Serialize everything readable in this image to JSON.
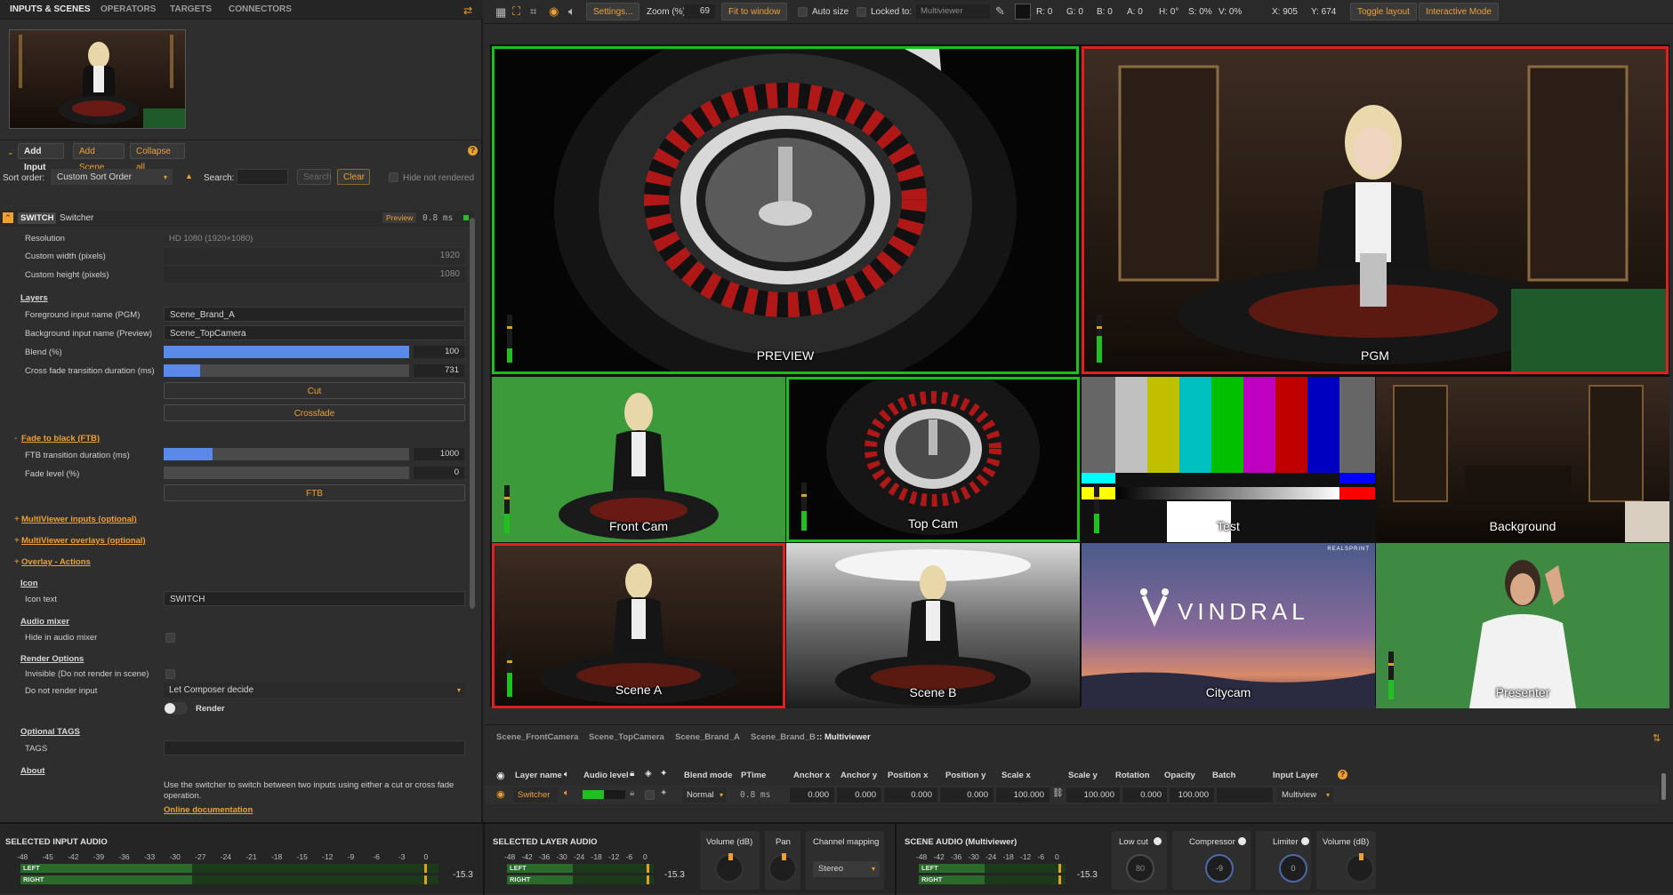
{
  "tabs": [
    "INPUTS & SCENES",
    "OPERATORS",
    "TARGETS",
    "CONNECTORS"
  ],
  "left": {
    "add_input": "Add Input",
    "add_scene": "Add Scene",
    "collapse_all": "Collapse all",
    "help": "?",
    "sort_order_label": "Sort order:",
    "sort_order_value": "Custom Sort Order",
    "search_label": "Search:",
    "search_button": "Search",
    "clear_button": "Clear",
    "hide_not_rendered": "Hide not rendered",
    "item_badge": "SWITCH",
    "item_name": "Switcher",
    "item_preview": "Preview",
    "item_time": "0.8 ms",
    "resolution_label": "Resolution",
    "resolution_value": "HD 1080 (1920×1080)",
    "custom_width_label": "Custom width (pixels)",
    "custom_width_value": "1920",
    "custom_height_label": "Custom height (pixels)",
    "custom_height_value": "1080",
    "layers_section": "Layers",
    "fg_label": "Foreground input name (PGM)",
    "fg_value": "Scene_Brand_A",
    "bg_label": "Background input name (Preview)",
    "bg_value": "Scene_TopCamera",
    "blend_label": "Blend (%)",
    "blend_value": "100",
    "blend_fraction": 1.0,
    "crossfade_label": "Cross fade transition duration (ms)",
    "crossfade_value": "731",
    "crossfade_fraction": 0.15,
    "cut_button": "Cut",
    "crossfade_button": "Crossfade",
    "ftb_section": "Fade to black (FTB)",
    "ftb_duration_label": "FTB transition duration (ms)",
    "ftb_duration_value": "1000",
    "ftb_duration_fraction": 0.2,
    "fade_level_label": "Fade level (%)",
    "fade_level_value": "0",
    "ftb_button": "FTB",
    "mv_inputs": "MultiViewer inputs (optional)",
    "mv_overlays": "MultiViewer overlays (optional)",
    "overlay_actions": "Overlay - Actions",
    "icon_section": "Icon",
    "icon_text_label": "Icon text",
    "icon_text_value": "SWITCH",
    "audio_mixer_section": "Audio mixer",
    "hide_audio_label": "Hide in audio mixer",
    "render_options_section": "Render Options",
    "invisible_label": "Invisible (Do not render in scene)",
    "do_not_render_label": "Do not render input",
    "do_not_render_value": "Let Composer decide",
    "render_toggle_label": "Render",
    "optional_tags_section": "Optional TAGS",
    "tags_label": "TAGS",
    "about_section": "About",
    "about_text": "Use the switcher to switch between two inputs using either a cut or cross fade operation.",
    "online_doc": "Online documentation"
  },
  "toolbar": {
    "settings": "Settings...",
    "zoom_label": "Zoom (%)",
    "zoom_value": "69",
    "fit": "Fit to window",
    "auto_size": "Auto size",
    "locked_to": "Locked to:",
    "locked_value": "Multiviewer",
    "r": "R: 0",
    "g": "G: 0",
    "b": "B: 0",
    "a": "A: 0",
    "h": "H: 0°",
    "s": "S: 0%",
    "v": "V: 0%",
    "x": "X: 905",
    "y": "Y: 674",
    "toggle_layout": "Toggle layout",
    "interactive": "Interactive Mode"
  },
  "multiviewer": {
    "preview": "PREVIEW",
    "pgm": "PGM",
    "front_cam": "Front Cam",
    "top_cam": "Top Cam",
    "test": "Test",
    "background": "Background",
    "scene_a": "Scene A",
    "scene_b": "Scene B",
    "citycam": "Citycam",
    "presenter": "Presenter",
    "vindral": "VINDRAL",
    "realsprint": "REALSPRINT"
  },
  "layers": {
    "tabs": [
      "Scene_FrontCamera",
      "Scene_TopCamera",
      "Scene_Brand_A",
      "Scene_Brand_B",
      ":: Multiviewer"
    ],
    "headers": {
      "layer_name": "Layer name",
      "audio_level": "Audio level",
      "blend_mode": "Blend mode",
      "ptime": "PTime",
      "anchor_x": "Anchor x",
      "anchor_y": "Anchor y",
      "pos_x": "Position x",
      "pos_y": "Position y",
      "scale_x": "Scale x",
      "scale_y": "Scale y",
      "rotation": "Rotation",
      "opacity": "Opacity",
      "batch": "Batch",
      "input_layer": "Input Layer"
    },
    "row": {
      "name": "Switcher",
      "blend": "Normal",
      "ptime": "0.8 ms",
      "anchor_x": "0.000",
      "anchor_y": "0.000",
      "pos_x": "0.000",
      "pos_y": "0.000",
      "scale_x": "100.000",
      "scale_y": "100.000",
      "rotation": "0.000",
      "opacity": "100.000",
      "batch": "",
      "input_layer": "Multiview"
    }
  },
  "audio": {
    "selected_input": "SELECTED INPUT AUDIO",
    "selected_layer": "SELECTED LAYER AUDIO",
    "scene_audio": "SCENE AUDIO (Multiviewer)",
    "left": "LEFT",
    "right": "RIGHT",
    "db_value": "-15.3",
    "scale_wide": [
      "-48",
      "-45",
      "-42",
      "-39",
      "-36",
      "-33",
      "-30",
      "-27",
      "-24",
      "-21",
      "-18",
      "-15",
      "-12",
      "-9",
      "-6",
      "-3",
      "0"
    ],
    "scale_narrow": [
      "-48",
      "-42",
      "-36",
      "-30",
      "-24",
      "-18",
      "-12",
      "-6",
      "0"
    ],
    "volume": "Volume (dB)",
    "pan": "Pan",
    "channel_mapping": "Channel mapping",
    "stereo": "Stereo",
    "low_cut": "Low cut",
    "low_cut_value": "80",
    "compressor": "Compressor",
    "compressor_value": "-9",
    "limiter": "Limiter",
    "limiter_value": "0"
  },
  "colors": {
    "accent": "#f0a030",
    "preview": "#18c018",
    "program": "#e02020",
    "slider": "#5a8ae8"
  }
}
